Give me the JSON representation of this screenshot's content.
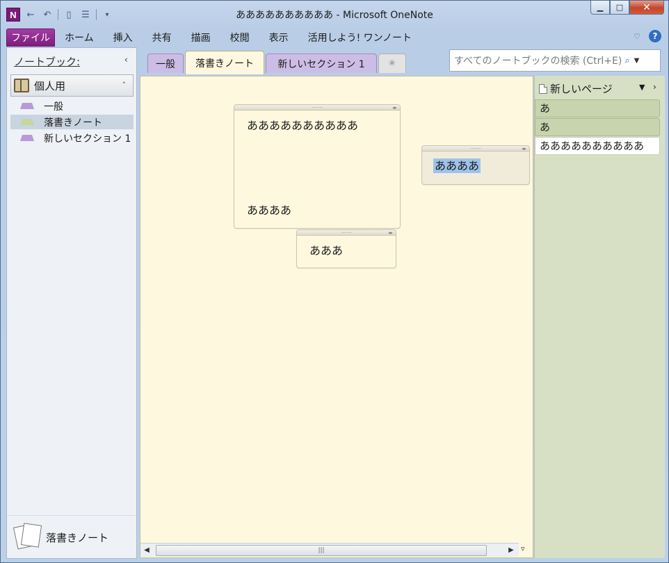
{
  "window": {
    "title": "ああああああああああ - Microsoft OneNote",
    "app_icon_letter": "N"
  },
  "ribbon": {
    "file_tab": "ファイル",
    "tabs": [
      "ホーム",
      "挿入",
      "共有",
      "描画",
      "校閲",
      "表示",
      "活用しよう! ワンノート"
    ]
  },
  "nav": {
    "header": "ノートブック:",
    "collapse_glyph": "‹",
    "notebook": "個人用",
    "sections": [
      {
        "label": "一般",
        "color": "#b89ad8"
      },
      {
        "label": "落書きノート",
        "color": "#c7d69a"
      },
      {
        "label": "新しいセクション 1",
        "color": "#b89ad8"
      }
    ],
    "footer": "落書きノート"
  },
  "section_tabs": [
    {
      "label": "一般"
    },
    {
      "label": "落書きノート"
    },
    {
      "label": "新しいセクション 1"
    },
    {
      "label": "✳"
    }
  ],
  "search": {
    "placeholder": "すべてのノートブックの検索 (Ctrl+E)"
  },
  "canvas": {
    "notes": [
      {
        "lines": [
          "ああああああああああ",
          "ああああ"
        ]
      },
      {
        "lines": [
          "あああ"
        ]
      },
      {
        "lines": [
          "ああああ"
        ]
      }
    ]
  },
  "pages_panel": {
    "new_page": "新しいページ",
    "pages": [
      "あ",
      "あ",
      "ああああああああああ"
    ],
    "selected_index": 2
  },
  "colors": {
    "file_tab": "#8a268a",
    "canvas": "#fef8df",
    "page_list": "#d7e0c5",
    "section_purple": "#cdbde6",
    "selection": "#9dc3ec"
  }
}
